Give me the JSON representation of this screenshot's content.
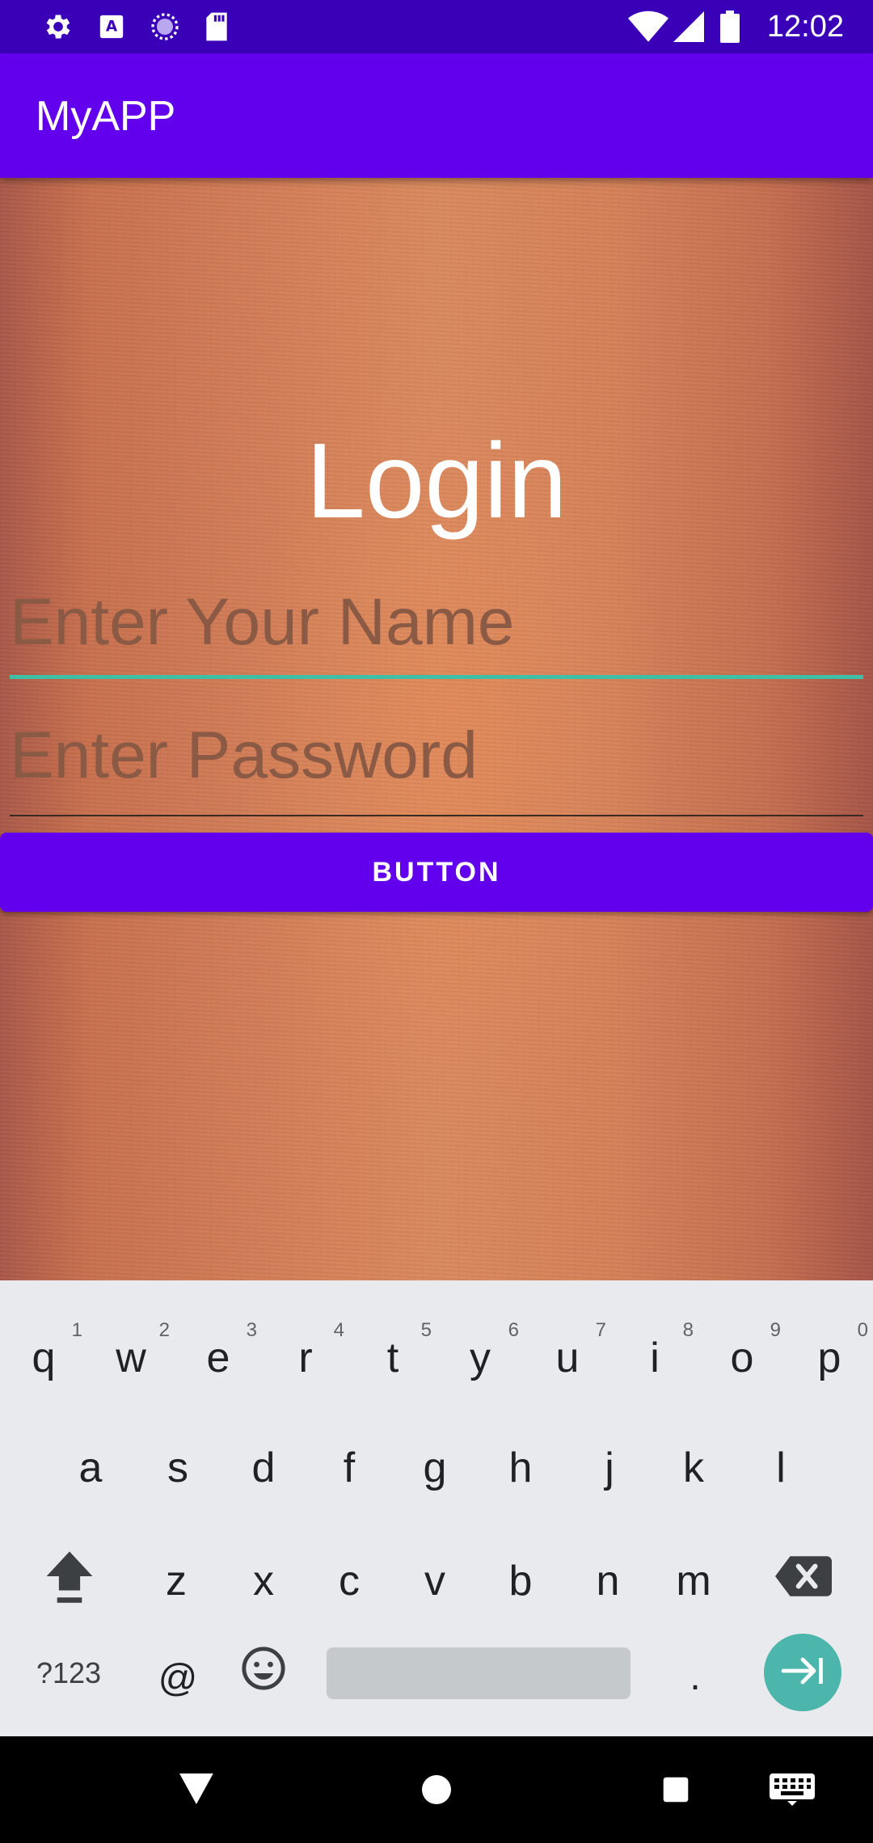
{
  "status_bar": {
    "time": "12:02",
    "left_icons": [
      "gear-icon",
      "font-icon",
      "sync-icon",
      "sd-card-icon"
    ],
    "right_icons": [
      "wifi-icon",
      "signal-icon",
      "battery-icon"
    ]
  },
  "app_bar": {
    "title": "MyAPP",
    "color": "#6200ee"
  },
  "login": {
    "title": "Login",
    "name_field": {
      "placeholder": "Enter Your Name",
      "value": ""
    },
    "password_field": {
      "placeholder": "Enter Password",
      "value": ""
    },
    "button_label": "BUTTON"
  },
  "keyboard": {
    "row1": [
      {
        "key": "q",
        "hint": "1"
      },
      {
        "key": "w",
        "hint": "2"
      },
      {
        "key": "e",
        "hint": "3"
      },
      {
        "key": "r",
        "hint": "4"
      },
      {
        "key": "t",
        "hint": "5"
      },
      {
        "key": "y",
        "hint": "6"
      },
      {
        "key": "u",
        "hint": "7"
      },
      {
        "key": "i",
        "hint": "8"
      },
      {
        "key": "o",
        "hint": "9"
      },
      {
        "key": "p",
        "hint": "0"
      }
    ],
    "row2": [
      "a",
      "s",
      "d",
      "f",
      "g",
      "h",
      "j",
      "k",
      "l"
    ],
    "row3": [
      "z",
      "x",
      "c",
      "v",
      "b",
      "n",
      "m"
    ],
    "symbols_label": "?123",
    "at_label": "@",
    "period_label": "."
  },
  "nav_bar": {
    "icons": [
      "back-icon",
      "home-icon",
      "recents-icon",
      "keyboard-icon"
    ]
  },
  "colors": {
    "accent": "#6200ee",
    "status_bar": "#3a00b8",
    "field_focus": "#3fbfa5"
  }
}
